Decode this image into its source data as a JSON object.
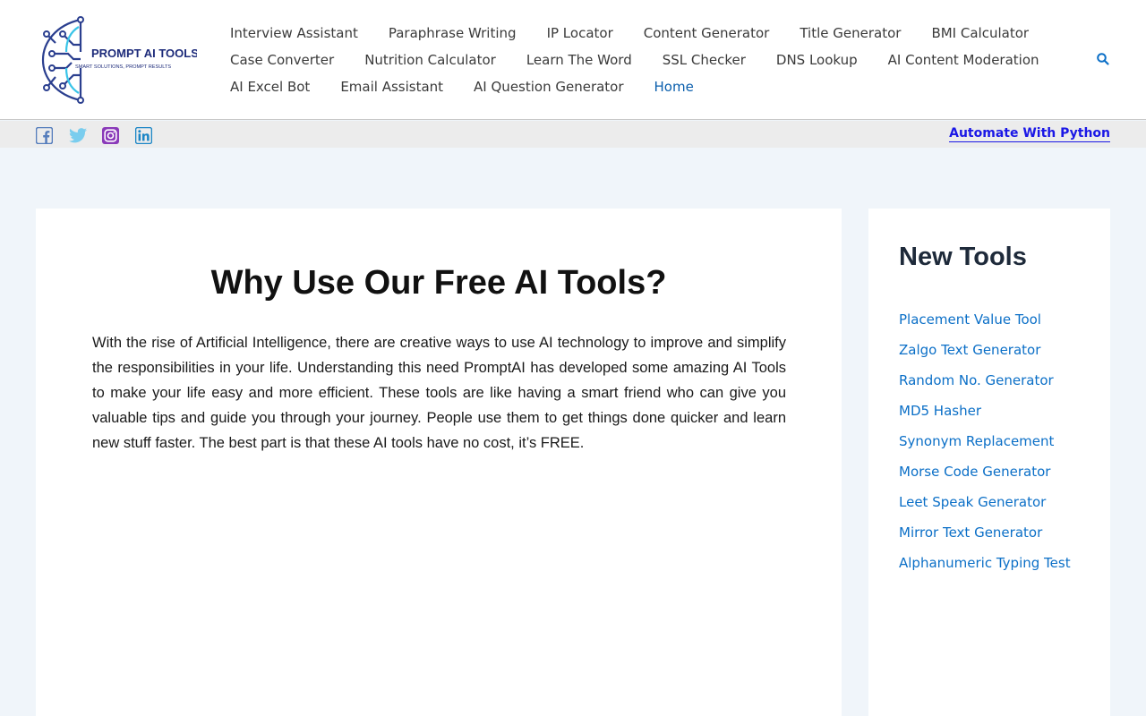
{
  "header": {
    "logo": {
      "brand": "PROMPT AI TOOLS",
      "tagline": "SMART SOLUTIONS, PROMPT RESULTS"
    },
    "nav": [
      {
        "label": "Interview Assistant"
      },
      {
        "label": "Paraphrase Writing"
      },
      {
        "label": "IP Locator"
      },
      {
        "label": "Content Generator"
      },
      {
        "label": "Title Generator"
      },
      {
        "label": "BMI Calculator"
      },
      {
        "label": "Case Converter"
      },
      {
        "label": "Nutrition Calculator"
      },
      {
        "label": "Learn The Word"
      },
      {
        "label": "SSL Checker"
      },
      {
        "label": "DNS Lookup"
      },
      {
        "label": "AI Content Moderation"
      },
      {
        "label": "AI Excel Bot"
      },
      {
        "label": "Email Assistant"
      },
      {
        "label": "AI Question Generator"
      },
      {
        "label": "Home"
      }
    ],
    "active_nav": "Home",
    "search_icon": "search-icon"
  },
  "social_bar": {
    "icons": [
      "facebook-icon",
      "twitter-icon",
      "instagram-icon",
      "linkedin-icon"
    ],
    "colors": {
      "facebook": "#557dbc",
      "twitter": "#7acdee",
      "instagram": "#8a3ab9",
      "linkedin": "#1c86c6"
    },
    "promo_link": "Automate With Python"
  },
  "main": {
    "title": "Why Use Our Free AI Tools?",
    "paragraph": "With the rise of Artificial Intelligence, there are creative ways to use AI technology to improve and simplify the responsibilities in your life. Understanding this need PromptAI has developed some amazing AI Tools to make your life easy and more efficient. These tools are like having a smart friend who can give you valuable tips and guide you through your journey. People use them to get things done quicker and learn new stuff faster. The best part is that these AI tools have no cost, it’s FREE."
  },
  "sidebar": {
    "title": "New Tools",
    "tools": [
      "Placement Value Tool",
      "Zalgo Text Generator",
      "Random No. Generator",
      "MD5 Hasher",
      "Synonym Replacement",
      "Morse Code Generator",
      "Leet Speak Generator",
      "Mirror Text Generator",
      "Alphanumeric Typing Test"
    ]
  },
  "colors": {
    "accent": "#0b6fc7",
    "promo": "#1a17e6",
    "page_bg": "#f0f5fa"
  }
}
